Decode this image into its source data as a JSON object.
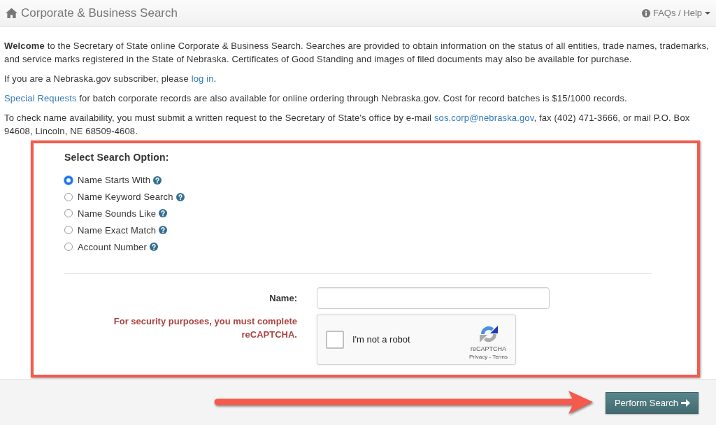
{
  "header": {
    "title": "Corporate & Business Search",
    "help_menu": "FAQs / Help"
  },
  "intro": [
    [
      {
        "kind": "text",
        "text": "**Welcome** to the Secretary of State online Corporate & Business Search. Searches are provided to obtain information on the status of all entities, trade names, trademarks, and service marks registered in the State of Nebraska. Certificates of Good Standing and images of filed documents may also be available for purchase."
      }
    ],
    [
      {
        "kind": "text",
        "text": "If you are a Nebraska.gov subscriber, please "
      },
      {
        "kind": "link",
        "text": "log in"
      },
      {
        "kind": "text",
        "text": "."
      }
    ],
    [
      {
        "kind": "link",
        "text": "Special Requests"
      },
      {
        "kind": "text",
        "text": " for batch corporate records are also available for online ordering through Nebraska.gov. Cost for record batches is $15/1000 records."
      }
    ],
    [
      {
        "kind": "text",
        "text": "To check name availability, you must submit a written request to the Secretary of State's office by e-mail "
      },
      {
        "kind": "link",
        "text": "sos.corp@nebraska.gov"
      },
      {
        "kind": "text",
        "text": ", fax (402) 471-3666, or mail P.O. Box 94608, Lincoln, NE 68509-4608."
      }
    ]
  ],
  "search_options": {
    "heading": "Select Search Option:",
    "options": [
      {
        "label": "Name Starts With",
        "selected": true
      },
      {
        "label": "Name Keyword Search",
        "selected": false
      },
      {
        "label": "Name Sounds Like",
        "selected": false
      },
      {
        "label": "Name Exact Match",
        "selected": false
      },
      {
        "label": "Account Number",
        "selected": false
      }
    ]
  },
  "name_field": {
    "label": "Name:"
  },
  "captcha": {
    "notice": "For security purposes, you must complete reCAPTCHA.",
    "label": "I'm not a robot",
    "checked": false,
    "brand": "reCAPTCHA",
    "links": "Privacy - Terms"
  },
  "actions": {
    "submit": "Perform Search"
  }
}
